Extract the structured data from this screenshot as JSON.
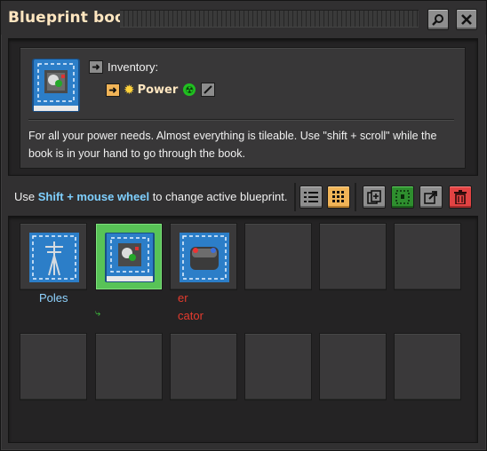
{
  "window": {
    "title": "Blueprint book",
    "search_icon": "search-icon",
    "close_icon": "close-icon"
  },
  "info": {
    "inventory_label": "Inventory:",
    "book_name": "Power",
    "description": "For all your power needs. Almost everything is tileable. Use \"shift + scroll\" while the book is in your hand to go through the book."
  },
  "toolbar": {
    "hint_prefix": "Use ",
    "hint_key": "Shift + mouse wheel",
    "hint_suffix": " to change active blueprint.",
    "buttons": [
      {
        "name": "list-view-icon",
        "active": false
      },
      {
        "name": "grid-view-icon",
        "active": true
      },
      {
        "name": "add-blueprint-icon",
        "active": false
      },
      {
        "name": "select-blueprint-icon",
        "active": true
      },
      {
        "name": "export-string-icon",
        "active": false
      },
      {
        "name": "trash-icon",
        "active": false
      }
    ]
  },
  "slots": [
    {
      "label": "Poles",
      "label_color": "#8fd3ff",
      "icon": "power-pole-icon"
    },
    {
      "label": "⤷",
      "label_color": "#3fcf3f",
      "icon": "blueprint-book-icon",
      "selected": true
    },
    {
      "label": "er\ncator",
      "label_color": "#e53b2e",
      "icon": "accumulator-icon"
    },
    {
      "label": "",
      "icon": ""
    },
    {
      "label": "",
      "icon": ""
    },
    {
      "label": "",
      "icon": ""
    },
    {
      "label": "",
      "icon": ""
    },
    {
      "label": "",
      "icon": ""
    },
    {
      "label": "",
      "icon": ""
    },
    {
      "label": "",
      "icon": ""
    },
    {
      "label": "",
      "icon": ""
    },
    {
      "label": "",
      "icon": ""
    }
  ],
  "colors": {
    "title": "#ffe6c0",
    "accent_orange": "#f1b457",
    "accent_green": "#58c357",
    "hint_key": "#7fd0ff"
  }
}
